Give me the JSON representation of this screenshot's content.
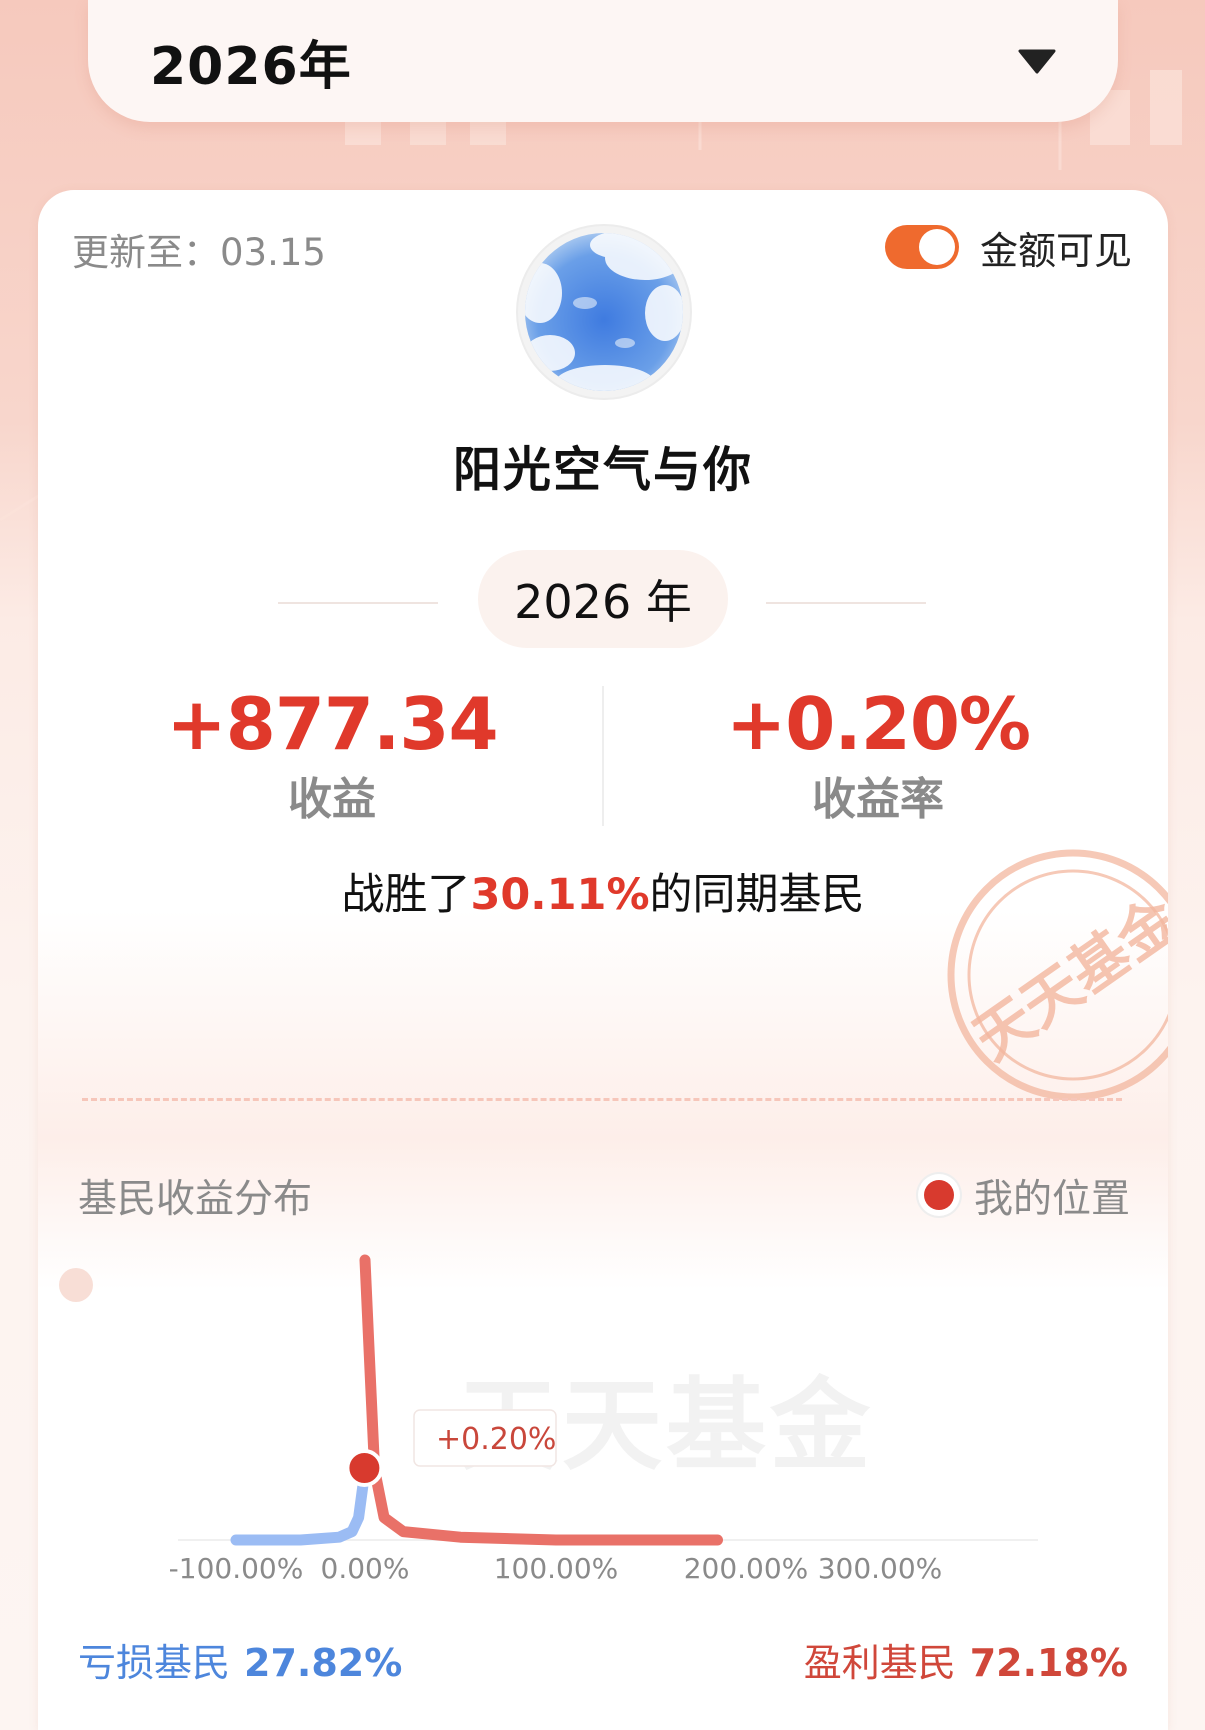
{
  "year_selector": {
    "value": "2026年",
    "caret_icon": "triangle-down-icon"
  },
  "card": {
    "update_label": "更新至：03.15",
    "amount_visible": {
      "label": "金额可见",
      "on": true,
      "color": "#ef6a2e"
    },
    "username": "阳光空气与你",
    "period": "2026 年",
    "income": {
      "value": "+877.34",
      "label": "收益"
    },
    "yield": {
      "value": "+0.20%",
      "label": "收益率"
    },
    "beat": {
      "prefix": "战胜了",
      "value": "30.11%",
      "suffix": "的同期基民"
    },
    "stamp_text": "天天基金"
  },
  "distribution": {
    "title": "基民收益分布",
    "legend_label": "我的位置",
    "watermark": "天天基金",
    "marker_label": "+0.20%",
    "loss": {
      "label": "亏损基民",
      "pct": "27.82%",
      "color": "#4d86dc"
    },
    "gain": {
      "label": "盈利基民",
      "pct": "72.18%",
      "color": "#d0473a"
    }
  },
  "chart_data": {
    "type": "area",
    "x_ticks": [
      "-100.00%",
      "0.00%",
      "100.00%",
      "200.00%",
      "300.00%"
    ],
    "marker": {
      "x": 0.2,
      "label": "+0.20%"
    },
    "series": [
      {
        "name": "亏损基民",
        "color": "#9bbcf4",
        "x": [
          -100,
          -50,
          -20,
          -10,
          -5,
          0
        ],
        "y": [
          0,
          0,
          1,
          3,
          8,
          25
        ]
      },
      {
        "name": "盈利基民",
        "color": "#e97168",
        "x": [
          0,
          2,
          5,
          10,
          20,
          50,
          100,
          150,
          185
        ],
        "y": [
          100,
          70,
          25,
          8,
          3,
          1,
          0,
          0,
          0
        ]
      }
    ]
  }
}
